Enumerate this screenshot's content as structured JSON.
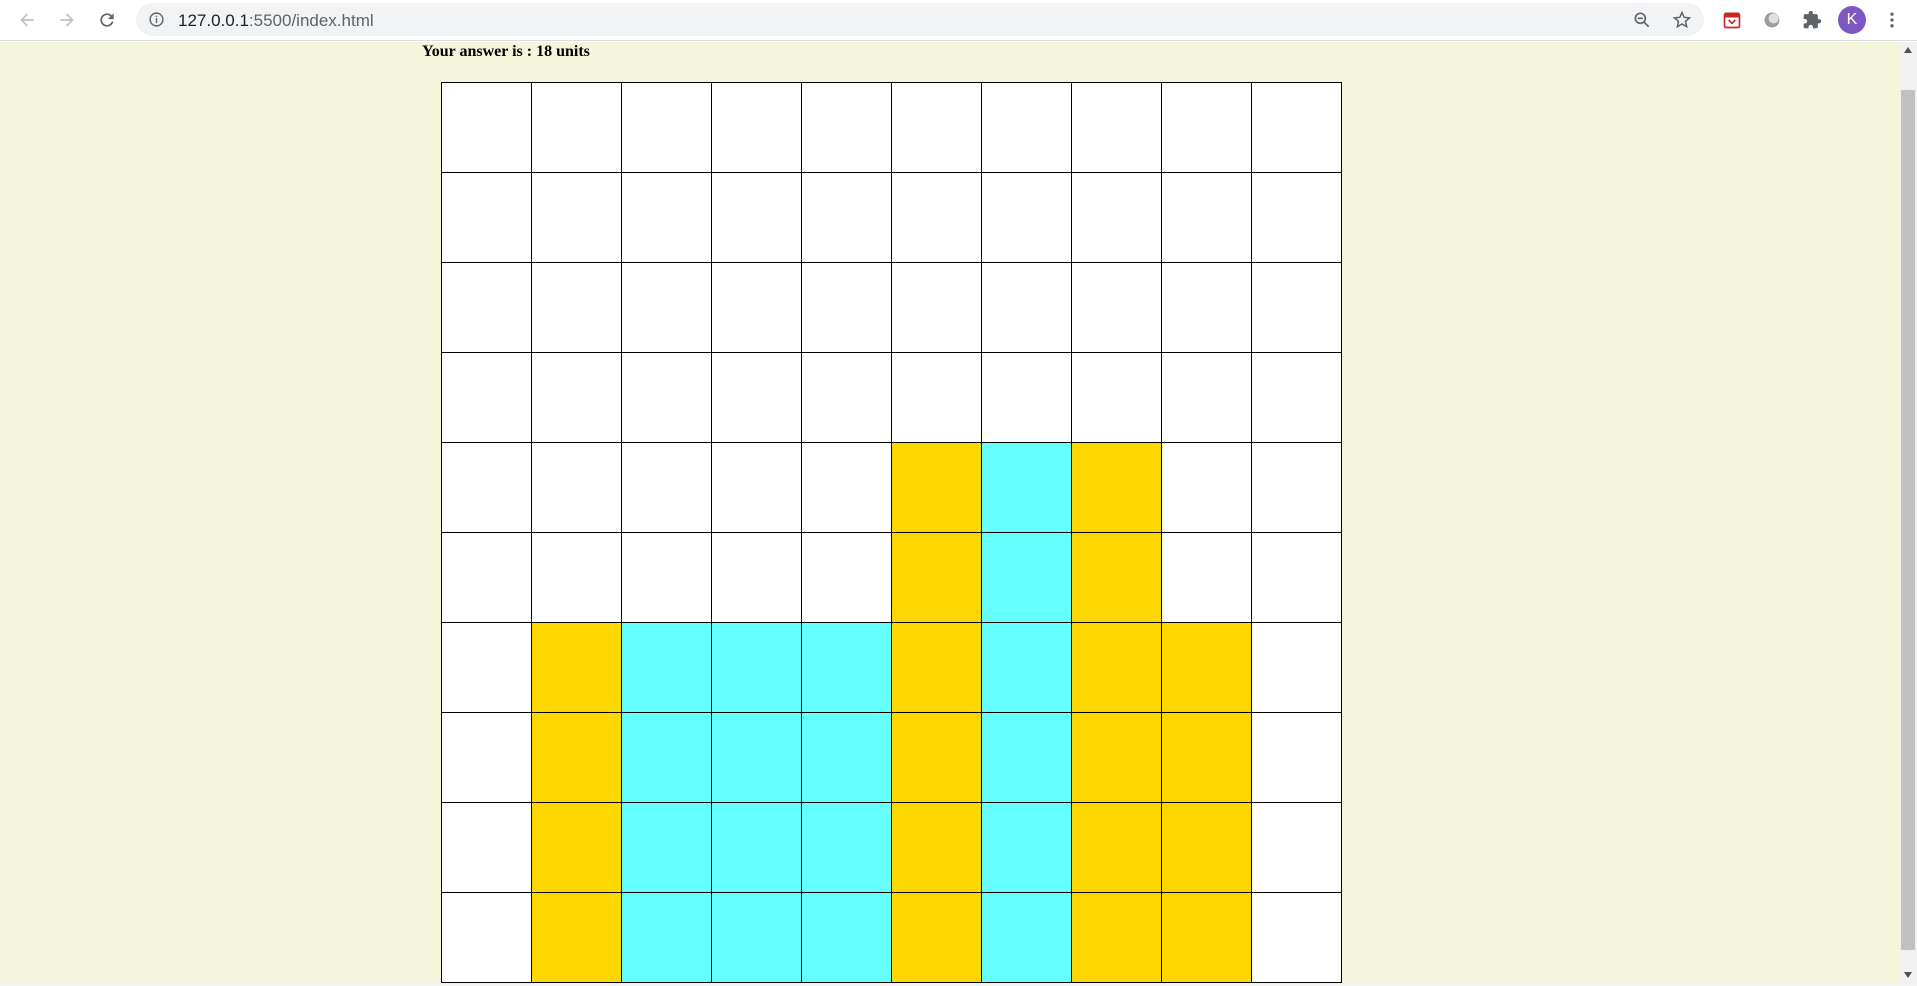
{
  "browser": {
    "url_host": "127.0.0.1",
    "url_rest": ":5500/index.html",
    "profile_initial": "K",
    "icons": [
      "back-arrow-icon",
      "forward-arrow-icon",
      "reload-icon",
      "info-icon",
      "zoom-out-icon",
      "star-icon",
      "calendar-extension-icon",
      "circle-extension-icon",
      "puzzle-icon",
      "more-vert-icon"
    ]
  },
  "page": {
    "answer_text": "Your answer is : 18 units",
    "background_color": "#f5f5dc"
  },
  "grid": {
    "rows": 10,
    "cols": 10,
    "colors": {
      "W": "#ffffff",
      "Y": "#ffd700",
      "C": "#66ffff"
    },
    "cells": [
      [
        "W",
        "W",
        "W",
        "W",
        "W",
        "W",
        "W",
        "W",
        "W",
        "W"
      ],
      [
        "W",
        "W",
        "W",
        "W",
        "W",
        "W",
        "W",
        "W",
        "W",
        "W"
      ],
      [
        "W",
        "W",
        "W",
        "W",
        "W",
        "W",
        "W",
        "W",
        "W",
        "W"
      ],
      [
        "W",
        "W",
        "W",
        "W",
        "W",
        "W",
        "W",
        "W",
        "W",
        "W"
      ],
      [
        "W",
        "W",
        "W",
        "W",
        "W",
        "Y",
        "C",
        "Y",
        "W",
        "W"
      ],
      [
        "W",
        "W",
        "W",
        "W",
        "W",
        "Y",
        "C",
        "Y",
        "W",
        "W"
      ],
      [
        "W",
        "Y",
        "C",
        "C",
        "C",
        "Y",
        "C",
        "Y",
        "Y",
        "W"
      ],
      [
        "W",
        "Y",
        "C",
        "C",
        "C",
        "Y",
        "C",
        "Y",
        "Y",
        "W"
      ],
      [
        "W",
        "Y",
        "C",
        "C",
        "C",
        "Y",
        "C",
        "Y",
        "Y",
        "W"
      ],
      [
        "W",
        "Y",
        "C",
        "C",
        "C",
        "Y",
        "C",
        "Y",
        "Y",
        "W"
      ]
    ]
  }
}
